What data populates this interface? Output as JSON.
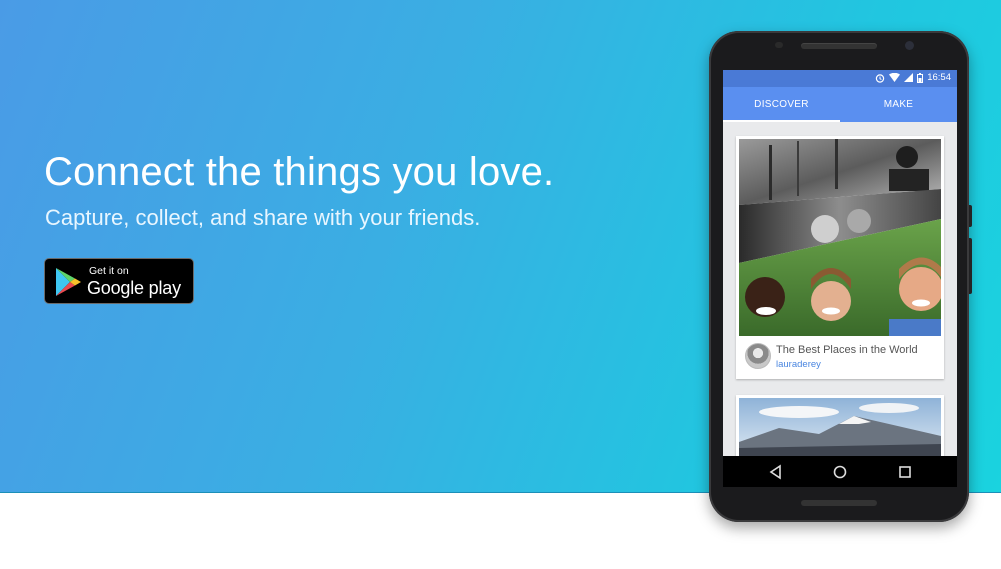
{
  "hero": {
    "headline": "Connect the things you love.",
    "subhead": "Capture, collect, and share with your friends."
  },
  "play_badge": {
    "small_text": "Get it on",
    "big_text": "Google play"
  },
  "phone": {
    "status_time": "16:54",
    "tabs": [
      {
        "label": "DISCOVER",
        "active": true
      },
      {
        "label": "MAKE",
        "active": false
      }
    ],
    "cards": [
      {
        "title": "The Best Places in the World",
        "user": "lauraderey"
      }
    ]
  },
  "colors": {
    "gradient_start": "#4a9be6",
    "gradient_end": "#1ad3df",
    "tab_bar": "#5a8ff0",
    "status_bar": "#4a7ad6",
    "link": "#4a86e0"
  }
}
